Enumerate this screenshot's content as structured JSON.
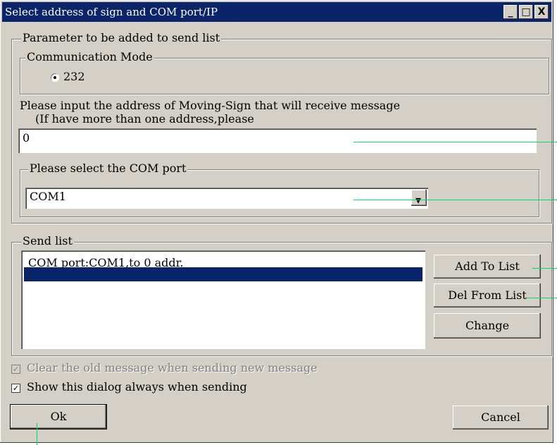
{
  "window": {
    "title": "Select address of sign and COM port/IP"
  },
  "titlebar_buttons": {
    "minimize": "_",
    "maximize": "□",
    "close": "X"
  },
  "params": {
    "legend": "Parameter to be added to send list",
    "comm_mode_legend": "Communication Mode",
    "mode_option": "232",
    "address_prompt_line1": "Please input the address of Moving-Sign that will receive message",
    "address_prompt_line2": "(If have more than one address,please",
    "address_value": "0",
    "com_legend": "Please select the COM port",
    "com_value": "COM1",
    "dropdown_arrow": "▾"
  },
  "send_list": {
    "legend": "Send list",
    "items": [
      "COM port:COM1,to 0 addr.",
      ""
    ],
    "add_label": "Add To List",
    "del_label": "Del From List",
    "change_label": "Change"
  },
  "options": {
    "clear_old_label": "Clear the old message when sending new message",
    "clear_old_checked": true,
    "clear_old_disabled": true,
    "show_dialog_label": "Show this dialog always when sending",
    "show_dialog_checked": true,
    "check_mark": "✓"
  },
  "footer": {
    "ok_label": "Ok",
    "cancel_label": "Cancel"
  },
  "colors": {
    "titlebar": "#0a246a",
    "selection": "#0a246a",
    "annotation": "#00e060"
  }
}
